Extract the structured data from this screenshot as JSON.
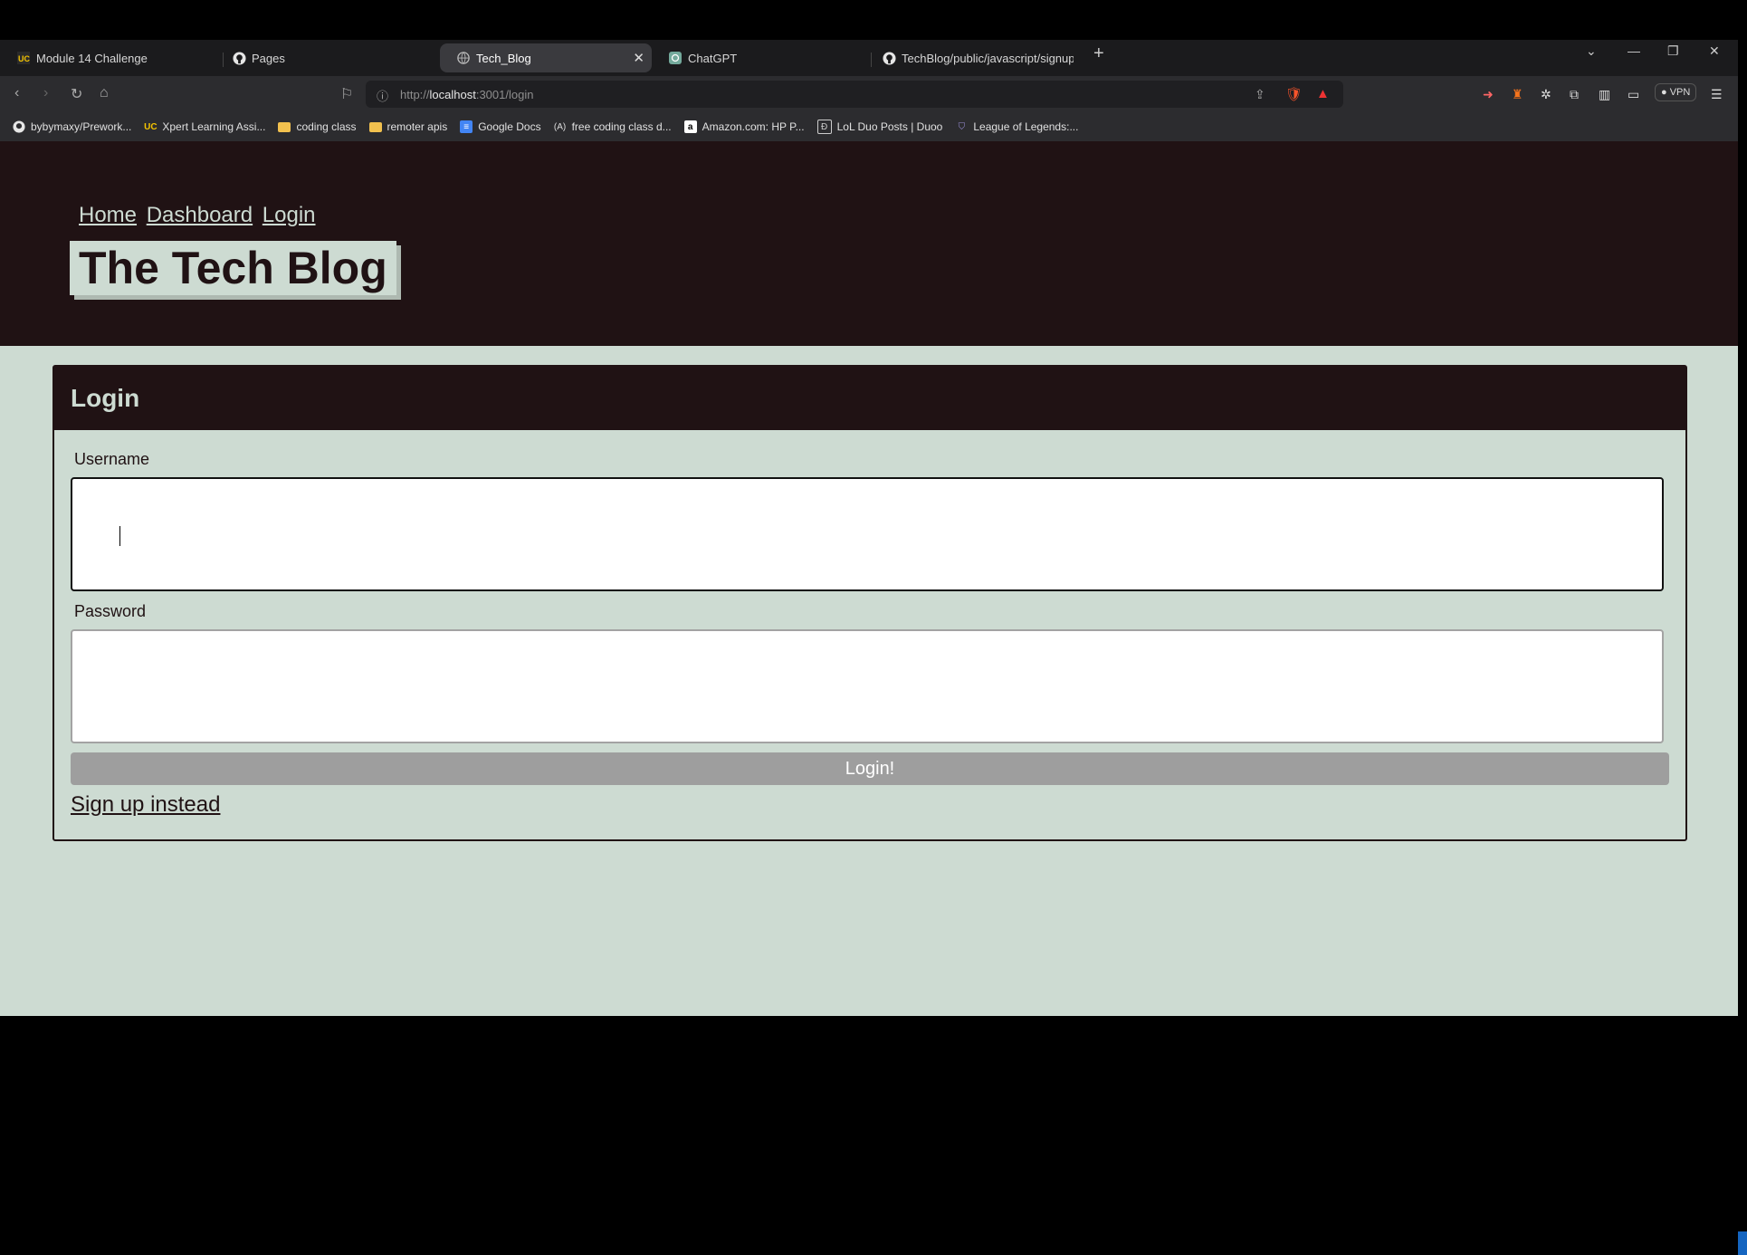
{
  "browser": {
    "tabs": [
      {
        "label": "Module 14 Challenge",
        "icon": "university-icon"
      },
      {
        "label": "Pages",
        "icon": "github-icon"
      },
      {
        "label": "Tech_Blog",
        "icon": "globe-icon",
        "active": true
      },
      {
        "label": "ChatGPT",
        "icon": "chatgpt-icon"
      },
      {
        "label": "TechBlog/public/javascript/signup.js",
        "icon": "github-icon"
      }
    ],
    "url_prefix": "http://",
    "url_host": "localhost",
    "url_rest": ":3001/login",
    "vpn_label": "VPN",
    "bookmarks": [
      {
        "label": "bybymaxy/Prework...",
        "icon": "github-icon"
      },
      {
        "label": "Xpert Learning Assi...",
        "icon": "university-icon"
      },
      {
        "label": "coding class",
        "icon": "folder-icon"
      },
      {
        "label": "remoter apis",
        "icon": "folder-icon"
      },
      {
        "label": "Google Docs",
        "icon": "docs-icon"
      },
      {
        "label": "free coding class d...",
        "icon": "code-icon"
      },
      {
        "label": "Amazon.com: HP P...",
        "icon": "amazon-icon"
      },
      {
        "label": "LoL Duo Posts | Duoo",
        "icon": "duoo-icon"
      },
      {
        "label": "League of Legends:...",
        "icon": "shield-icon"
      }
    ]
  },
  "site": {
    "nav": [
      "Home",
      "Dashboard",
      "Login"
    ],
    "title": "The Tech Blog"
  },
  "login_form": {
    "heading": "Login",
    "username_label": "Username",
    "username_value": "",
    "password_label": "Password",
    "password_value": "",
    "submit_label": "Login!",
    "signup_link": "Sign up instead"
  },
  "colors": {
    "header_bg": "#201214",
    "page_bg": "#cddbd2",
    "button_bg": "#9e9e9e"
  }
}
